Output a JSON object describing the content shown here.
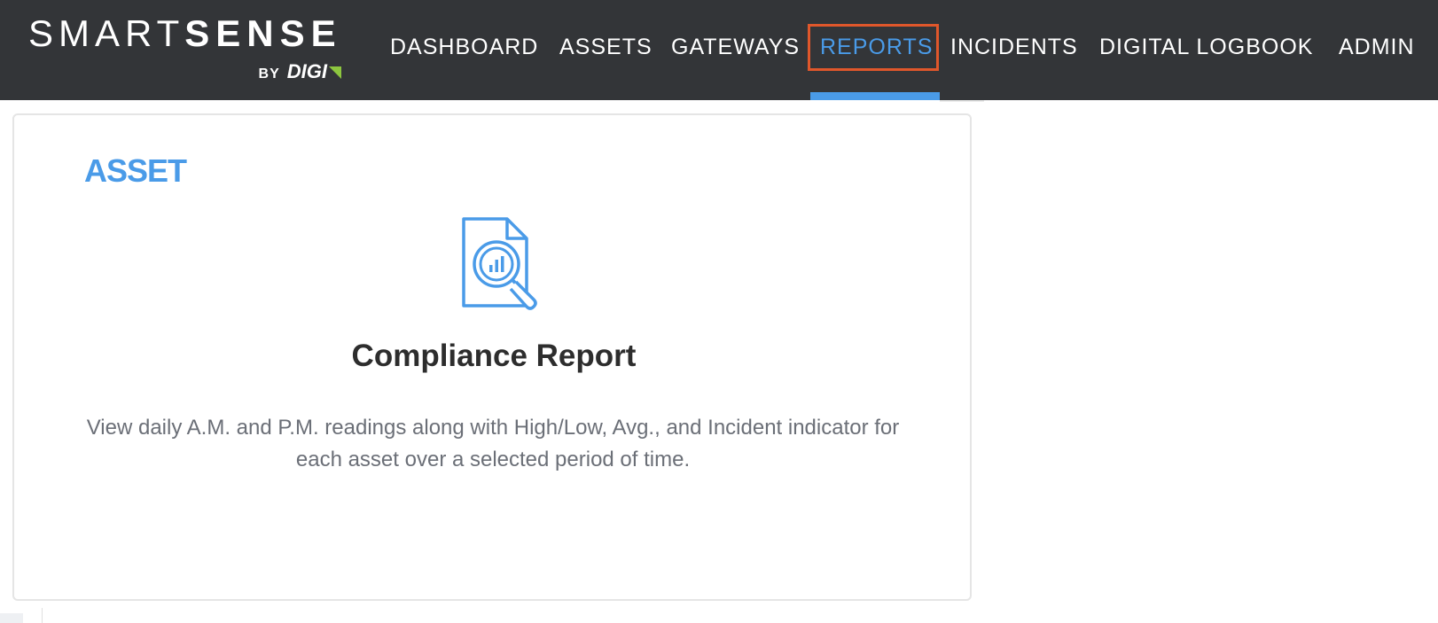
{
  "brand": {
    "name_light": "SMART",
    "name_bold": "SENSE",
    "by": "BY",
    "company": "DIGI",
    "accent_color": "#8dc63f"
  },
  "nav": {
    "items": [
      {
        "label": "DASHBOARD",
        "active": false
      },
      {
        "label": "ASSETS",
        "active": false
      },
      {
        "label": "GATEWAYS",
        "active": false
      },
      {
        "label": "REPORTS",
        "active": true
      },
      {
        "label": "INCIDENTS",
        "active": false
      },
      {
        "label": "DIGITAL LOGBOOK",
        "active": false
      },
      {
        "label": "ADMIN",
        "active": false
      }
    ],
    "active_color": "#4a9be8",
    "highlight_color": "#e0572b"
  },
  "report_card": {
    "category": "ASSET",
    "icon": "report-magnifier-icon",
    "title": "Compliance Report",
    "description": "View daily A.M. and P.M. readings along with High/Low, Avg., and Incident indicator for each asset over a selected period of time."
  }
}
